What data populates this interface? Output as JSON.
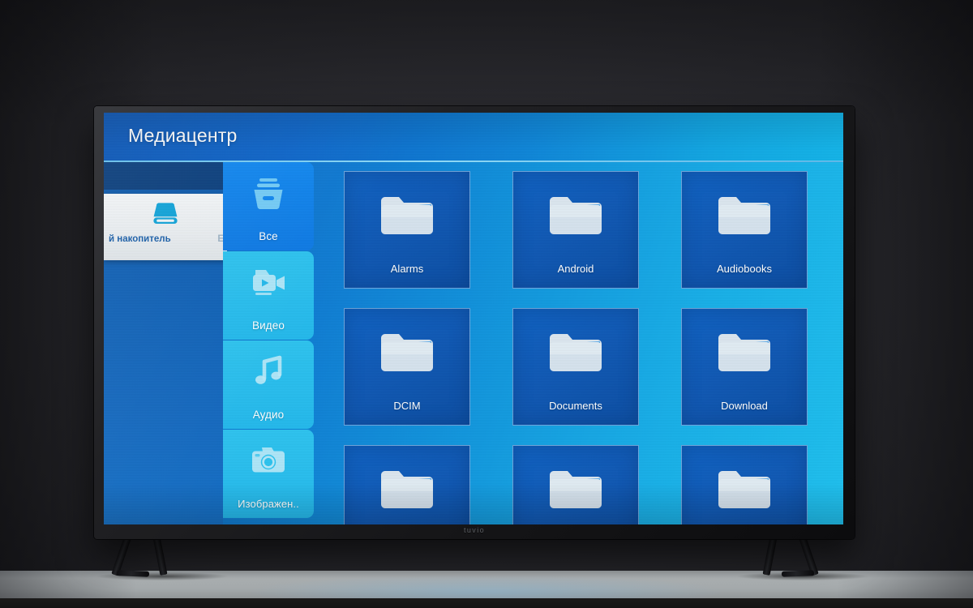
{
  "scene": {
    "device_brand": "tuvio"
  },
  "screen": {
    "header": {
      "title": "Медиацентр"
    },
    "drive_selector": {
      "icon": "hard-drive-icon",
      "label": "й накопитель",
      "label_truncated_right": "Е"
    },
    "categories": [
      {
        "label": "Все",
        "icon": "archive-box-icon",
        "selected": true
      },
      {
        "label": "Видео",
        "icon": "video-camera-icon",
        "selected": false
      },
      {
        "label": "Аудио",
        "icon": "music-note-icon",
        "selected": false
      },
      {
        "label": "Изображен..",
        "icon": "camera-icon",
        "selected": false
      }
    ],
    "folders": [
      {
        "label": "Alarms",
        "icon": "folder-icon",
        "cut": false
      },
      {
        "label": "Android",
        "icon": "folder-icon",
        "cut": false
      },
      {
        "label": "Audiobooks",
        "icon": "folder-icon",
        "cut": false
      },
      {
        "label": "DCIM",
        "icon": "folder-icon",
        "cut": false
      },
      {
        "label": "Documents",
        "icon": "folder-icon",
        "cut": false
      },
      {
        "label": "Download",
        "icon": "folder-icon",
        "cut": false
      },
      {
        "label": "",
        "icon": "folder-icon",
        "cut": true
      },
      {
        "label": "",
        "icon": "folder-icon",
        "cut": true
      },
      {
        "label": "",
        "icon": "folder-icon",
        "cut": true
      }
    ]
  },
  "colors": {
    "header_left": "#0a56b6",
    "header_right": "#14b4e8",
    "body_left": "#0c5fc0",
    "body_right": "#1fc0ee",
    "category_selected": "#1287ef",
    "category_normal": "#2ec3ef",
    "tile_bg": "#0f62c2",
    "drive_card_bg": "#f2f5f7",
    "drive_label_text": "#1b5fa8",
    "wall": "#2b2b30",
    "table": "#b4b9bb"
  }
}
